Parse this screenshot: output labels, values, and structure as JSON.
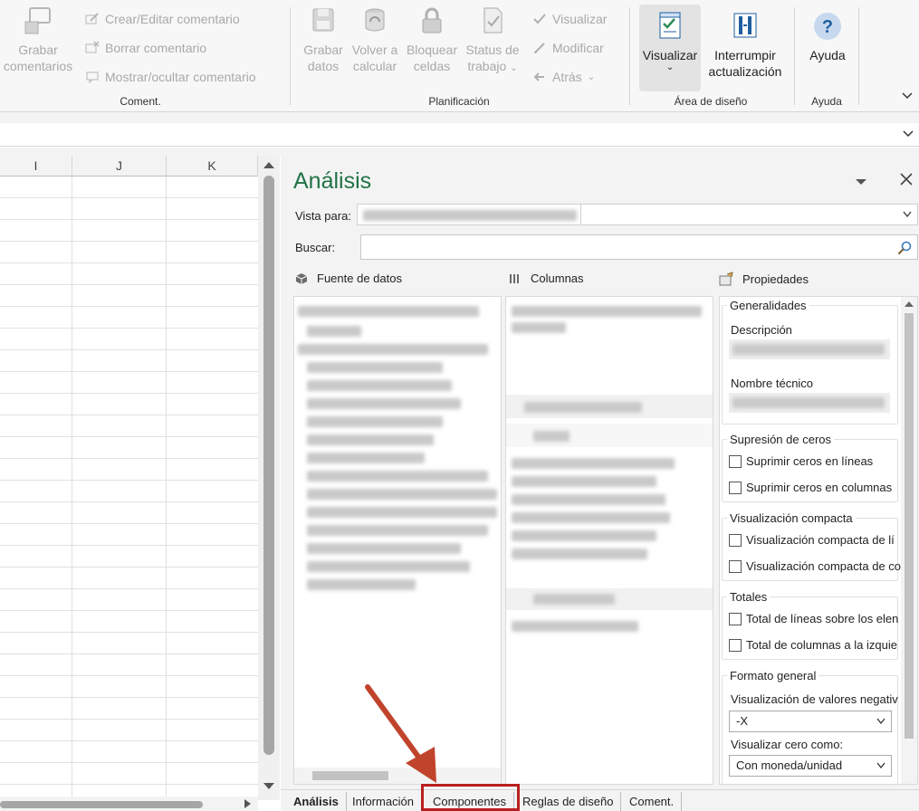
{
  "ribbon": {
    "coment_group": {
      "label": "Coment.",
      "grabar_line1": "Grabar",
      "grabar_line2": "comentarios",
      "crear": "Crear/Editar comentario",
      "borrar": "Borrar comentario",
      "mostrar": "Mostrar/ocultar comentario"
    },
    "planificacion_group": {
      "label": "Planificación",
      "grabar_line1": "Grabar",
      "grabar_line2": "datos",
      "volver_line1": "Volver a",
      "volver_line2": "calcular",
      "bloquear_line1": "Bloquear",
      "bloquear_line2": "celdas",
      "status_line1": "Status de",
      "status_line2": "trabajo",
      "visualizar": "Visualizar",
      "modificar": "Modificar",
      "atras": "Atrás"
    },
    "area_group": {
      "label": "Área de diseño",
      "visualizar": "Visualizar",
      "interrumpir_line1": "Interrumpir",
      "interrumpir_line2": "actualización"
    },
    "ayuda_group": {
      "label": "Ayuda",
      "ayuda": "Ayuda"
    }
  },
  "grid": {
    "columns": [
      "I",
      "J",
      "K"
    ]
  },
  "panel": {
    "title": "Análisis",
    "vista_label": "Vista para:",
    "buscar_label": "Buscar:",
    "fuente_header": "Fuente de datos",
    "columnas_header": "Columnas",
    "propiedades_header": "Propiedades",
    "props": {
      "generalidades": "Generalidades",
      "descripcion": "Descripción",
      "nombre_tecnico": "Nombre técnico",
      "supresion": "Supresión de ceros",
      "suprimir_lineas": "Suprimir ceros en líneas",
      "suprimir_columnas": "Suprimir ceros en columnas",
      "visualizacion_compacta": "Visualización compacta",
      "compacta_1": "Visualización compacta de lí",
      "compacta_2": "Visualización compacta de co",
      "totales": "Totales",
      "total_lineas": "Total de líneas sobre los elen",
      "total_columnas": "Total de columnas a la izquie",
      "formato_general": "Formato general",
      "valores_negativos_label": "Visualización de valores negativ",
      "valores_negativos_value": "-X",
      "cero_label": "Visualizar cero como:",
      "cero_value": "Con moneda/unidad"
    },
    "tabs": [
      "Análisis",
      "Información",
      "Componentes",
      "Reglas de diseño",
      "Coment."
    ],
    "active_tab": "Análisis",
    "highlighted_tab": "Componentes"
  },
  "colors": {
    "title_green": "#217346",
    "highlight_red": "#b91f1f",
    "arrow": "#c0442c"
  }
}
